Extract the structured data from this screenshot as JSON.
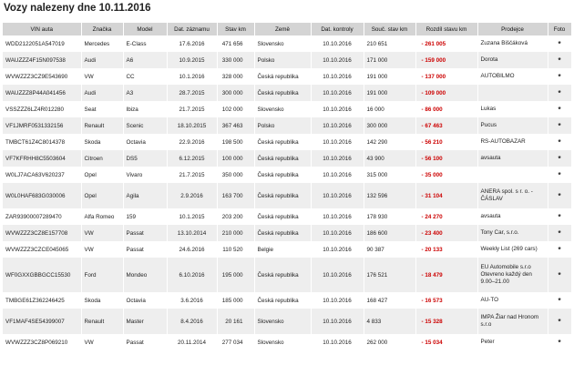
{
  "title": "Vozy nalezeny dne 10.11.2016",
  "columns": [
    "VIN auta",
    "Značka",
    "Model",
    "Dat. záznamu",
    "Stav km",
    "Země",
    "Dat. kontroly",
    "Souč. stav km",
    "Rozdíl stavu km",
    "Prodejce",
    "Foto"
  ],
  "rows": [
    {
      "vin": "WDD2122051A547019",
      "brand": "Mercedes",
      "model": "E-Class",
      "date": "17.6.2016",
      "km": "471 656",
      "country": "Slovensko",
      "check": "10.10.2016",
      "current": "210 651",
      "diff": "- 261 005",
      "seller": "Zuzana Biščáková",
      "foto": "*"
    },
    {
      "vin": "WAUZZZ4F15N097538",
      "brand": "Audi",
      "model": "A6",
      "date": "10.9.2015",
      "km": "330 000",
      "country": "Polsko",
      "check": "10.10.2016",
      "current": "171 000",
      "diff": "- 159 000",
      "seller": "Dorota",
      "foto": "*"
    },
    {
      "vin": "WVWZZZ3CZ9E543690",
      "brand": "VW",
      "model": "CC",
      "date": "10.1.2016",
      "km": "328 000",
      "country": "Česká republika",
      "check": "10.10.2016",
      "current": "191 000",
      "diff": "- 137 000",
      "seller": "AUTOBILMO",
      "foto": "*"
    },
    {
      "vin": "WAUZZZ8P44A041456",
      "brand": "Audi",
      "model": "A3",
      "date": "28.7.2015",
      "km": "300 000",
      "country": "Česká republika",
      "check": "10.10.2016",
      "current": "191 000",
      "diff": "- 109 000",
      "seller": "",
      "foto": "*"
    },
    {
      "vin": "VSSZZZ6LZ4R012280",
      "brand": "Seat",
      "model": "Ibiza",
      "date": "21.7.2015",
      "km": "102 000",
      "country": "Slovensko",
      "check": "10.10.2016",
      "current": "16 000",
      "diff": "- 86 000",
      "seller": "Lukas",
      "foto": "*"
    },
    {
      "vin": "VF1JMRF0531332156",
      "brand": "Renault",
      "model": "Scenic",
      "date": "18.10.2015",
      "km": "367 463",
      "country": "Polsko",
      "check": "10.10.2016",
      "current": "300 000",
      "diff": "- 67 463",
      "seller": "Pucus",
      "foto": "*"
    },
    {
      "vin": "TMBCT61Z4C8014378",
      "brand": "Skoda",
      "model": "Octavia",
      "date": "22.9.2016",
      "km": "198 500",
      "country": "Česká republika",
      "check": "10.10.2016",
      "current": "142 290",
      "diff": "- 56 210",
      "seller": "RS-AUTOBAZAR",
      "foto": "*"
    },
    {
      "vin": "VF7KFRHH8C5503604",
      "brand": "Citroen",
      "model": "DS5",
      "date": "6.12.2015",
      "km": "100 000",
      "country": "Česká republika",
      "check": "10.10.2016",
      "current": "43 900",
      "diff": "- 56 100",
      "seller": "avsauta",
      "foto": "*"
    },
    {
      "vin": "W0LJ7ACA63V620237",
      "brand": "Opel",
      "model": "Vivaro",
      "date": "21.7.2015",
      "km": "350 000",
      "country": "Česká republika",
      "check": "10.10.2016",
      "current": "315 000",
      "diff": "- 35 000",
      "seller": "",
      "foto": "*"
    },
    {
      "vin": "W0L0HAF683G030006",
      "brand": "Opel",
      "model": "Agila",
      "date": "2.9.2016",
      "km": "163 700",
      "country": "Česká republika",
      "check": "10.10.2016",
      "current": "132 596",
      "diff": "- 31 104",
      "seller": "ANERA spol. s r. o. - ČÁSLAV",
      "foto": "*"
    },
    {
      "vin": "ZAR93900007289470",
      "brand": "Alfa Romeo",
      "model": "159",
      "date": "10.1.2015",
      "km": "203 200",
      "country": "Česká republika",
      "check": "10.10.2016",
      "current": "178 930",
      "diff": "- 24 270",
      "seller": "avsauta",
      "foto": "*"
    },
    {
      "vin": "WVWZZZ3CZ8E157708",
      "brand": "VW",
      "model": "Passat",
      "date": "13.10.2014",
      "km": "210 000",
      "country": "Česká republika",
      "check": "10.10.2016",
      "current": "186 600",
      "diff": "- 23 400",
      "seller": "Tony Car, s.r.o.",
      "foto": "*"
    },
    {
      "vin": "WVWZZZ3CZCE045065",
      "brand": "VW",
      "model": "Passat",
      "date": "24.6.2016",
      "km": "110 520",
      "country": "Belgie",
      "check": "10.10.2016",
      "current": "90 387",
      "diff": "- 20 133",
      "seller": "Weekly List (269 cars)",
      "foto": "*"
    },
    {
      "vin": "WF0GXXGBBGCC15530",
      "brand": "Ford",
      "model": "Mondeo",
      "date": "6.10.2016",
      "km": "195 000",
      "country": "Česká republika",
      "check": "10.10.2016",
      "current": "176 521",
      "diff": "- 18 479",
      "seller": "EU Automobile s.r.o Otevreno každý den 9.00–21.00",
      "foto": "*"
    },
    {
      "vin": "TMBGE61Z362246425",
      "brand": "Skoda",
      "model": "Octavia",
      "date": "3.6.2016",
      "km": "185 000",
      "country": "Česká republika",
      "check": "10.10.2016",
      "current": "168 427",
      "diff": "- 16 573",
      "seller": "AU-TO",
      "foto": "*"
    },
    {
      "vin": "VF1MAF4SE54399007",
      "brand": "Renault",
      "model": "Master",
      "date": "8.4.2016",
      "km": "20 161",
      "country": "Slovensko",
      "check": "10.10.2016",
      "current": "4 833",
      "diff": "- 15 328",
      "seller": "IMPA Žiar nad Hronom s.r.o",
      "foto": "*"
    },
    {
      "vin": "WVWZZZ3CZ8P069210",
      "brand": "VW",
      "model": "Passat",
      "date": "20.11.2014",
      "km": "277 034",
      "country": "Slovensko",
      "check": "10.10.2016",
      "current": "262 000",
      "diff": "- 15 034",
      "seller": "Peter",
      "foto": "*"
    }
  ]
}
